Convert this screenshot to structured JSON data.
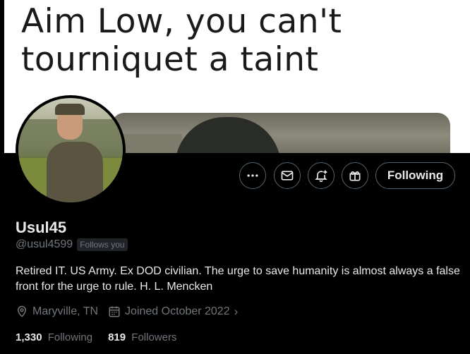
{
  "banner": {
    "text_line1": "Aim Low, you can't",
    "text_line2": "tourniquet a taint"
  },
  "actions": {
    "more_icon": "ellipsis-icon",
    "message_icon": "envelope-icon",
    "notify_icon": "bell-plus-icon",
    "subscribe_icon": "gift-icon",
    "follow_label": "Following"
  },
  "profile": {
    "name": "Usul45",
    "handle": "@usul4599",
    "follows_badge": "Follows you",
    "bio": "Retired IT. US Army. Ex DOD civilian. The urge to save humanity is almost always a false front for the urge to rule. H. L. Mencken",
    "location": "Maryville, TN",
    "joined": "Joined October 2022",
    "following_count": "1,330",
    "following_label": "Following",
    "followers_count": "819",
    "followers_label": "Followers"
  },
  "colors": {
    "background": "#000000",
    "text": "#e7e9ea",
    "muted": "#71767b",
    "border": "#536471"
  }
}
